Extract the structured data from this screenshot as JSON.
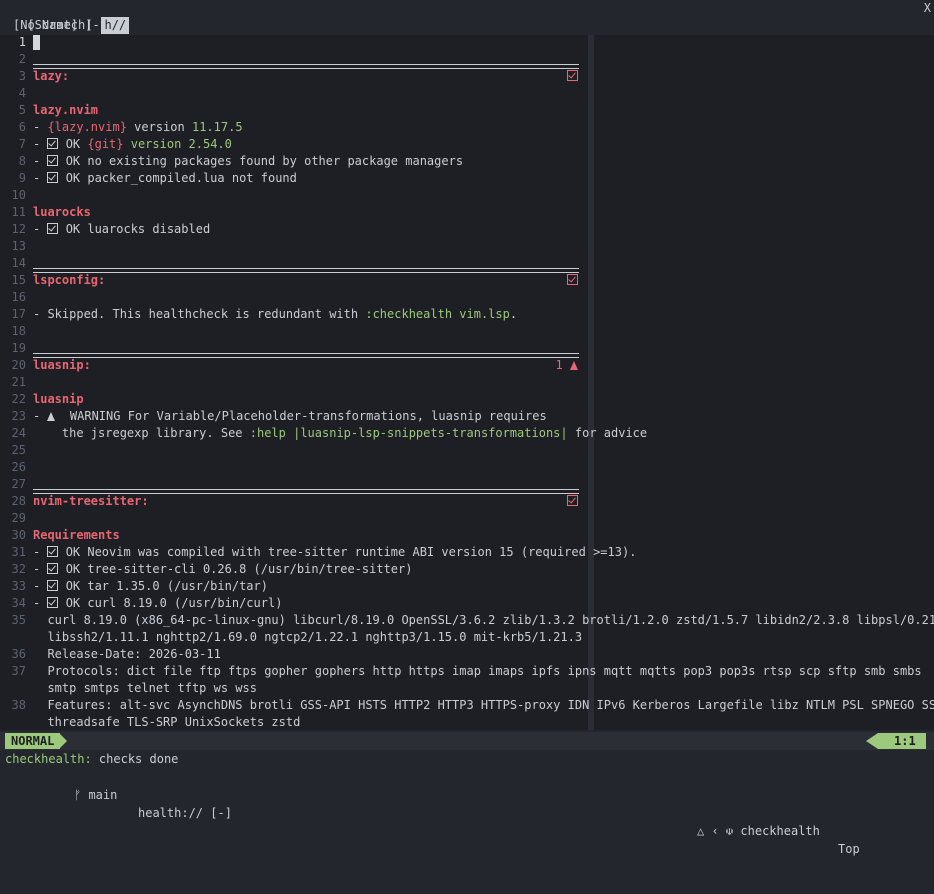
{
  "tabline": {
    "tabs": [
      {
        "label": "[Scratch]",
        "active": false
      },
      {
        "label": "h//",
        "active": true
      }
    ],
    "close_label": "X"
  },
  "winbar": {
    "title": "[No Name] [-]"
  },
  "lines": [
    {
      "n": "1",
      "current": true
    },
    {
      "n": "2"
    },
    {
      "n": "3",
      "title": "lazy:",
      "badge": "check"
    },
    {
      "n": "4"
    },
    {
      "n": "5",
      "heading": "lazy.nvim"
    },
    {
      "n": "6",
      "parts": [
        [
          "- ",
          ""
        ],
        [
          "{lazy.nvim}",
          "red"
        ],
        [
          " version ",
          ""
        ],
        [
          "11.17.5",
          "green"
        ]
      ]
    },
    {
      "n": "7",
      "check": true,
      "parts": [
        [
          "OK ",
          ""
        ],
        [
          "{git}",
          "red"
        ],
        [
          " version 2.54.0",
          "green"
        ]
      ]
    },
    {
      "n": "8",
      "check": true,
      "parts": [
        [
          "OK no existing packages found by other package managers",
          ""
        ]
      ]
    },
    {
      "n": "9",
      "check": true,
      "parts": [
        [
          "OK packer_compiled.lua not found",
          ""
        ]
      ]
    },
    {
      "n": "10"
    },
    {
      "n": "11",
      "heading": "luarocks"
    },
    {
      "n": "12",
      "check": true,
      "parts": [
        [
          "OK luarocks disabled",
          ""
        ]
      ]
    },
    {
      "n": "13"
    },
    {
      "n": "14"
    },
    {
      "n": "15",
      "title": "lspconfig:",
      "badge": "check"
    },
    {
      "n": "16"
    },
    {
      "n": "17",
      "parts": [
        [
          "- Skipped. This healthcheck is redundant with ",
          ""
        ],
        [
          ":checkhealth vim.lsp",
          "green"
        ],
        [
          ".",
          ""
        ]
      ]
    },
    {
      "n": "18"
    },
    {
      "n": "19"
    },
    {
      "n": "20",
      "title": "luasnip:",
      "badge": "warn",
      "badge_text": "1"
    },
    {
      "n": "21"
    },
    {
      "n": "22",
      "heading": "luasnip"
    },
    {
      "n": "23",
      "warn": true,
      "parts": [
        [
          "WARNING For Variable/Placeholder-transformations, luasnip requires",
          ""
        ]
      ]
    },
    {
      "n": "24",
      "parts": [
        [
          "    the jsregexp library. See ",
          ""
        ],
        [
          ":help |luasnip-lsp-snippets-transformations|",
          "green"
        ],
        [
          " for advice",
          ""
        ]
      ]
    },
    {
      "n": "25"
    },
    {
      "n": "26"
    },
    {
      "n": "27"
    },
    {
      "n": "28",
      "title": "nvim-treesitter:",
      "badge": "check"
    },
    {
      "n": "29"
    },
    {
      "n": "30",
      "heading": "Requirements"
    },
    {
      "n": "31",
      "check": true,
      "parts": [
        [
          "OK Neovim was compiled with tree-sitter runtime ABI version 15 (required >=13).",
          ""
        ]
      ]
    },
    {
      "n": "32",
      "check": true,
      "parts": [
        [
          "OK tree-sitter-cli 0.26.8 (/usr/bin/tree-sitter)",
          ""
        ]
      ]
    },
    {
      "n": "33",
      "check": true,
      "parts": [
        [
          "OK tar 1.35.0 (/usr/bin/tar)",
          ""
        ]
      ]
    },
    {
      "n": "34",
      "check": true,
      "parts": [
        [
          "OK curl 8.19.0 (/usr/bin/curl)",
          ""
        ]
      ]
    },
    {
      "n": "35",
      "parts": [
        [
          "  curl 8.19.0 (x86_64-pc-linux-gnu) libcurl/8.19.0 OpenSSL/3.6.2 zlib/1.3.2 brotli/1.2.0 zstd/1.5.7 libidn2/2.3.8 libpsl/0.21.5",
          ""
        ]
      ]
    },
    {
      "n": "",
      "parts": [
        [
          "  libssh2/1.11.1 nghttp2/1.69.0 ngtcp2/1.22.1 nghttp3/1.15.0 mit-krb5/1.21.3",
          ""
        ]
      ]
    },
    {
      "n": "36",
      "parts": [
        [
          "  Release-Date: 2026-03-11",
          ""
        ]
      ]
    },
    {
      "n": "37",
      "parts": [
        [
          "  Protocols: dict file ftp ftps gopher gophers http https imap imaps ipfs ipns mqtt mqtts pop3 pop3s rtsp scp sftp smb smbs",
          ""
        ]
      ]
    },
    {
      "n": "",
      "parts": [
        [
          "  smtp smtps telnet tftp ws wss",
          ""
        ]
      ]
    },
    {
      "n": "38",
      "parts": [
        [
          "  Features: alt-svc AsynchDNS brotli GSS-API HSTS HTTP2 HTTP3 HTTPS-proxy IDN IPv6 Kerberos Largefile libz NTLM PSL SPNEGO SSL",
          ""
        ]
      ]
    },
    {
      "n": "",
      "parts": [
        [
          "  threadsafe TLS-SRP UnixSockets zstd",
          ""
        ]
      ]
    }
  ],
  "statusline": {
    "mode": "NORMAL",
    "branch": "main",
    "file": "health:// [-]",
    "filetype": "checkhealth",
    "scroll": "Top",
    "position": "1:1"
  },
  "cmdline": {
    "prefix": "checkhealth:",
    "message": " checks done"
  },
  "colors": {
    "accent": "#9cc97b",
    "heading": "#e86671",
    "background": "#1e1f24"
  }
}
